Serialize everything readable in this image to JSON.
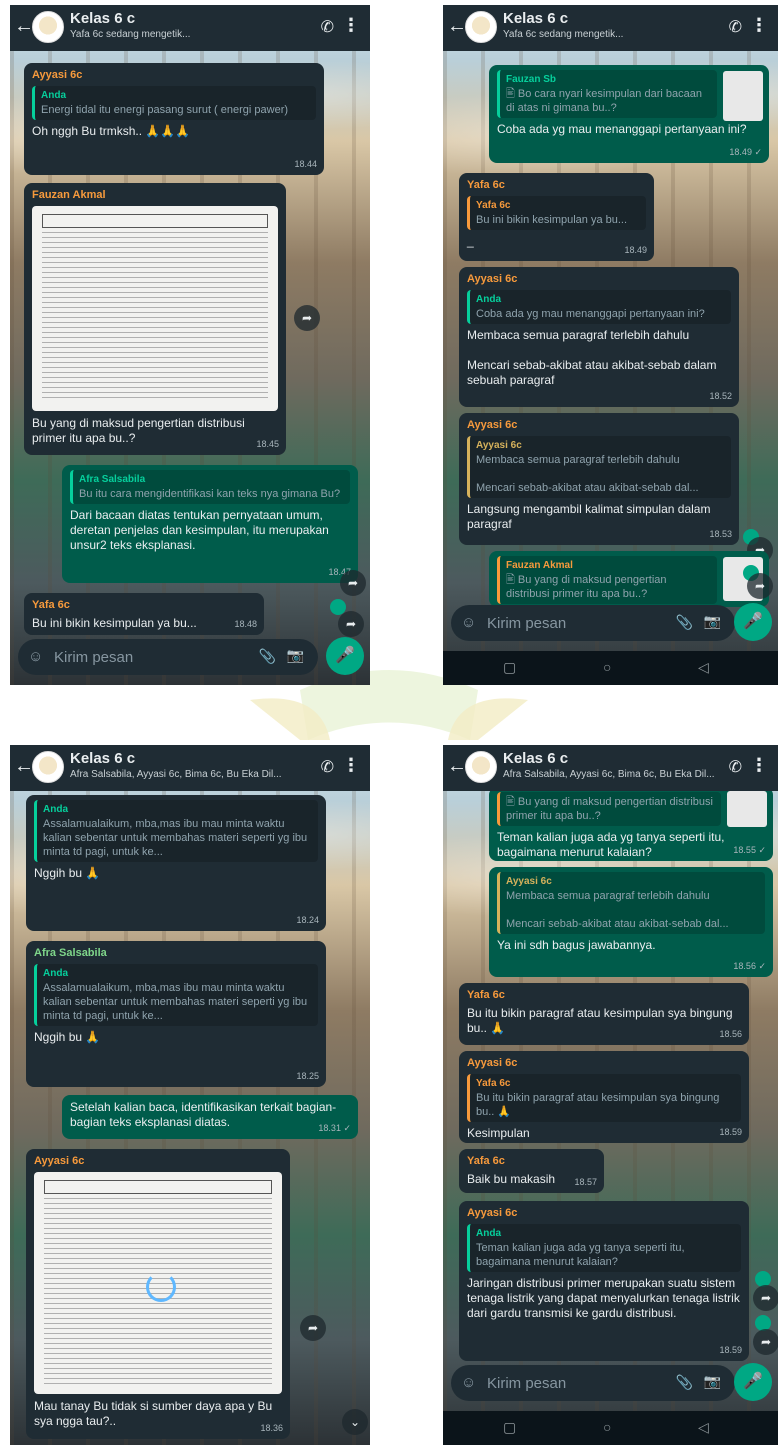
{
  "p1": {
    "title": "Kelas 6 c",
    "subtitle": "Yafa 6c sedang mengetik...",
    "m1": {
      "sender": "Ayyasi 6c",
      "quote_name": "Anda",
      "quote_text": "Energi tidal itu energi pasang surut ( energi pawer)",
      "text": "Oh nggh Bu trmksh.. 🙏🙏🙏",
      "time": "18.44"
    },
    "m2": {
      "sender": "Fauzan Akmal",
      "text": "Bu yang di maksud pengertian distribusi primer itu apa bu..?",
      "time": "18.45"
    },
    "m3": {
      "quote_name": "Afra Salsabila",
      "quote_text": "Bu itu cara mengidentifikasi kan teks nya gimana Bu?",
      "text": "Dari bacaan diatas tentukan pernyataan umum, deretan penjelas dan kesimpulan, itu merupakan unsur2 teks eksplanasi.",
      "time": "18.47"
    },
    "m4": {
      "sender": "Yafa 6c",
      "text": "Bu ini bikin kesimpulan ya bu...",
      "time": "18.48"
    },
    "input_placeholder": "Kirim pesan"
  },
  "p2": {
    "title": "Kelas 6 c",
    "subtitle": "Yafa 6c sedang mengetik...",
    "m1": {
      "quote_name": "Fauzan Sb",
      "quote_text": "🖹 Bo cara nyari kesimpulan dari bacaan di atas  ni gimana bu..?",
      "text": "Coba ada yg mau menanggapi pertanyaan ini?",
      "time": "18.49 ✓"
    },
    "m2": {
      "sender": "Yafa 6c",
      "quote_name": "Yafa 6c",
      "quote_text": "Bu ini bikin kesimpulan ya bu...",
      "text": "_",
      "time": "18.49"
    },
    "m3": {
      "sender": "Ayyasi 6c",
      "quote_name": "Anda",
      "quote_text": "Coba ada yg mau menanggapi pertanyaan ini?",
      "text": "Membaca semua paragraf terlebih dahulu\n\nMencari sebab-akibat atau akibat-sebab dalam sebuah paragraf",
      "time": "18.52"
    },
    "m4": {
      "sender": "Ayyasi 6c",
      "quote_name": "Ayyasi 6c",
      "quote_text": "Membaca semua paragraf terlebih dahulu\n\nMencari sebab-akibat atau akibat-sebab dal...",
      "text": "Langsung mengambil kalimat simpulan dalam paragraf",
      "time": "18.53"
    },
    "m5": {
      "quote_name": "Fauzan Akmal",
      "quote_text": "🖹 Bu yang di maksud pengertian distribusi primer itu apa bu..?"
    },
    "input_placeholder": "Kirim pesan"
  },
  "p3": {
    "title": "Kelas 6 c",
    "subtitle": "Afra Salsabila, Ayyasi 6c, Bima 6c, Bu Eka Dil...",
    "m1": {
      "quote_name": "Anda",
      "quote_text": "Assalamualaikum, mba,mas ibu mau minta waktu kalian sebentar untuk membahas materi seperti yg ibu minta td pagi, untuk ke...",
      "text": "Nggih bu 🙏",
      "time": "18.24"
    },
    "m2": {
      "sender": "Afra Salsabila",
      "quote_name": "Anda",
      "quote_text": "Assalamualaikum, mba,mas ibu mau minta waktu kalian sebentar untuk membahas materi seperti yg ibu minta td pagi, untuk ke...",
      "text": "Nggih bu 🙏",
      "time": "18.25"
    },
    "m3": {
      "text": "Setelah kalian baca, identifikasikan terkait bagian-bagian teks eksplanasi diatas.",
      "time": "18.31 ✓"
    },
    "m4": {
      "sender": "Ayyasi 6c",
      "text": "Mau tanay Bu tidak si sumber daya apa y Bu sya ngga tau?..",
      "time": "18.36"
    }
  },
  "p4": {
    "title": "Kelas 6 c",
    "subtitle": "Afra Salsabila, Ayyasi 6c, Bima 6c, Bu Eka Dil...",
    "m1": {
      "quote_text": "🖹 Bu yang di maksud pengertian distribusi primer itu apa bu..?",
      "text": "Teman kalian juga ada yg tanya seperti itu, bagaimana menurut kalaian?",
      "time": "18.55 ✓"
    },
    "m2": {
      "quote_name": "Ayyasi 6c",
      "quote_text": "Membaca semua paragraf terlebih dahulu\n\nMencari sebab-akibat atau akibat-sebab dal...",
      "text": "Ya ini sdh bagus jawabannya.",
      "time": "18.56 ✓"
    },
    "m3": {
      "sender": "Yafa 6c",
      "text": "Bu itu bikin paragraf atau kesimpulan sya bingung bu.. 🙏",
      "time": "18.56"
    },
    "m4": {
      "sender": "Ayyasi 6c",
      "quote_name": "Yafa 6c",
      "quote_text": "Bu itu bikin paragraf atau kesimpulan sya bingung bu.. 🙏",
      "text": "Kesimpulan",
      "time": "18.59"
    },
    "m5": {
      "sender": "Yafa 6c",
      "text": "Baik bu makasih",
      "time": "18.57"
    },
    "m6": {
      "sender": "Ayyasi 6c",
      "quote_name": "Anda",
      "quote_text": "Teman kalian juga ada yg tanya seperti itu, bagaimana menurut kalaian?",
      "text": "Jaringan distribusi primer merupakan suatu sistem tenaga listrik yang dapat menyalurkan tenaga listrik dari gardu transmisi ke gardu distribusi.",
      "time": "18.59"
    },
    "input_placeholder": "Kirim pesan"
  },
  "icons": {
    "back": "back-arrow-icon",
    "call": "add-call-icon",
    "more": "more-vert-icon",
    "emoji": "emoji-icon",
    "attach": "paperclip-icon",
    "camera": "camera-icon",
    "mic": "mic-icon",
    "forward": "forward-icon"
  },
  "colors": {
    "topbar": "#1f2c34",
    "incoming": "#1f2c34",
    "outgoing": "#005c4b",
    "accent": "#00a884"
  }
}
